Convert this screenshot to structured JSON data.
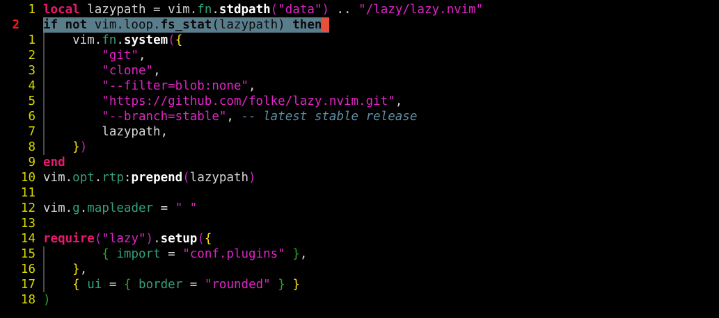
{
  "editor": {
    "lines": [
      {
        "num": "1",
        "tokens": [
          [
            "kw",
            "local"
          ],
          [
            "plain",
            " lazypath = vim"
          ],
          [
            "plain",
            "."
          ],
          [
            "field",
            "fn"
          ],
          [
            "plain",
            "."
          ],
          [
            "fn",
            "stdpath"
          ],
          [
            "p2",
            "("
          ],
          [
            "str",
            "\"data\""
          ],
          [
            "p2",
            ")"
          ],
          [
            "plain",
            " .. "
          ],
          [
            "str",
            "\"/lazy/lazy.nvim\""
          ]
        ]
      },
      {
        "num": "2",
        "current": true,
        "tokens": [
          [
            "hl-bold",
            "if not"
          ],
          [
            "hl-text",
            " vim.loop."
          ],
          [
            "hl-bold",
            "fs_stat"
          ],
          [
            "hl-text",
            "(lazypath) "
          ],
          [
            "hl-bold",
            "then"
          ]
        ]
      },
      {
        "num": "1",
        "guide": true,
        "tokens": [
          [
            "plain",
            "    vim"
          ],
          [
            "plain",
            "."
          ],
          [
            "field",
            "fn"
          ],
          [
            "plain",
            "."
          ],
          [
            "fn",
            "system"
          ],
          [
            "p2",
            "("
          ],
          [
            "p1",
            "{"
          ]
        ]
      },
      {
        "num": "2",
        "guide": true,
        "tokens": [
          [
            "plain",
            "        "
          ],
          [
            "str",
            "\"git\""
          ],
          [
            "plain",
            ","
          ]
        ]
      },
      {
        "num": "3",
        "guide": true,
        "tokens": [
          [
            "plain",
            "        "
          ],
          [
            "str",
            "\"clone\""
          ],
          [
            "plain",
            ","
          ]
        ]
      },
      {
        "num": "4",
        "guide": true,
        "tokens": [
          [
            "plain",
            "        "
          ],
          [
            "str",
            "\"--filter=blob:none\""
          ],
          [
            "plain",
            ","
          ]
        ]
      },
      {
        "num": "5",
        "guide": true,
        "tokens": [
          [
            "plain",
            "        "
          ],
          [
            "str",
            "\"https://github.com/folke/lazy.nvim.git\""
          ],
          [
            "plain",
            ","
          ]
        ]
      },
      {
        "num": "6",
        "guide": true,
        "tokens": [
          [
            "plain",
            "        "
          ],
          [
            "str",
            "\"--branch=stable\""
          ],
          [
            "plain",
            ", "
          ],
          [
            "cm",
            "-- latest stable release"
          ]
        ]
      },
      {
        "num": "7",
        "guide": true,
        "tokens": [
          [
            "plain",
            "        lazypath,"
          ]
        ]
      },
      {
        "num": "8",
        "guide": true,
        "tokens": [
          [
            "plain",
            "    "
          ],
          [
            "p1",
            "}"
          ],
          [
            "p2",
            ")"
          ]
        ]
      },
      {
        "num": "9",
        "tokens": [
          [
            "kw",
            "end"
          ]
        ]
      },
      {
        "num": "10",
        "tokens": [
          [
            "plain",
            "vim"
          ],
          [
            "plain",
            "."
          ],
          [
            "field",
            "opt"
          ],
          [
            "plain",
            "."
          ],
          [
            "field",
            "rtp"
          ],
          [
            "plain",
            ":"
          ],
          [
            "fn",
            "prepend"
          ],
          [
            "p2",
            "("
          ],
          [
            "plain",
            "lazypath"
          ],
          [
            "p2",
            ")"
          ]
        ]
      },
      {
        "num": "11",
        "tokens": []
      },
      {
        "num": "12",
        "tokens": [
          [
            "plain",
            "vim"
          ],
          [
            "plain",
            "."
          ],
          [
            "field",
            "g"
          ],
          [
            "plain",
            "."
          ],
          [
            "field",
            "mapleader"
          ],
          [
            "plain",
            " = "
          ],
          [
            "str",
            "\" \""
          ]
        ]
      },
      {
        "num": "13",
        "tokens": []
      },
      {
        "num": "14",
        "tokens": [
          [
            "kw",
            "require"
          ],
          [
            "p2",
            "("
          ],
          [
            "str",
            "\"lazy\""
          ],
          [
            "p2",
            ")"
          ],
          [
            "plain",
            "."
          ],
          [
            "fn",
            "setup"
          ],
          [
            "p2",
            "("
          ],
          [
            "p1",
            "{"
          ]
        ]
      },
      {
        "num": "15",
        "guide": true,
        "tokens": [
          [
            "plain",
            "        "
          ],
          [
            "p3",
            "{"
          ],
          [
            "plain",
            " "
          ],
          [
            "field",
            "import"
          ],
          [
            "plain",
            " = "
          ],
          [
            "str",
            "\"conf.plugins\""
          ],
          [
            "plain",
            " "
          ],
          [
            "p3",
            "}"
          ],
          [
            "plain",
            ","
          ]
        ]
      },
      {
        "num": "16",
        "guide": true,
        "tokens": [
          [
            "plain",
            "    "
          ],
          [
            "p1",
            "}"
          ],
          [
            "plain",
            ","
          ]
        ]
      },
      {
        "num": "17",
        "guide": true,
        "tokens": [
          [
            "plain",
            "    "
          ],
          [
            "p1",
            "{"
          ],
          [
            "plain",
            " "
          ],
          [
            "field",
            "ui"
          ],
          [
            "plain",
            " = "
          ],
          [
            "p3",
            "{"
          ],
          [
            "plain",
            " "
          ],
          [
            "field",
            "border"
          ],
          [
            "plain",
            " = "
          ],
          [
            "str",
            "\"rounded\""
          ],
          [
            "plain",
            " "
          ],
          [
            "p3",
            "}"
          ],
          [
            "plain",
            " "
          ],
          [
            "p1",
            "}"
          ]
        ]
      },
      {
        "num": "18",
        "tokens": [
          [
            "p3",
            ")"
          ]
        ]
      }
    ]
  }
}
